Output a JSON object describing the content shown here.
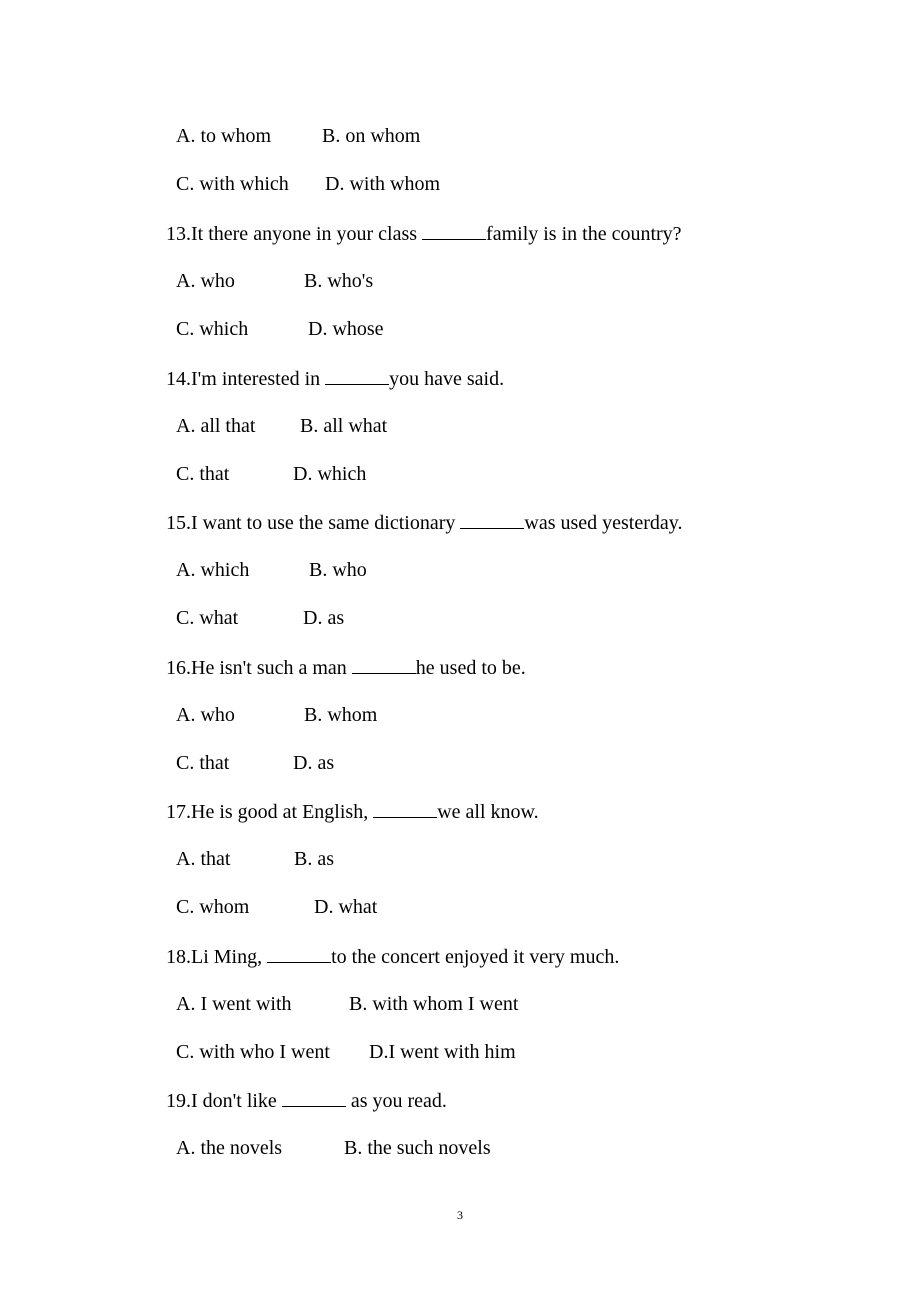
{
  "options_continued": {
    "rows": [
      [
        "A. to whom",
        "B. on whom"
      ],
      [
        "C. with which",
        "D. with whom"
      ]
    ]
  },
  "questions": [
    {
      "number": "13.",
      "before": "It there anyone in your class ",
      "after": "family is in the country?",
      "rows": [
        [
          "A. who",
          "B. who's"
        ],
        [
          "C. which",
          "D. whose"
        ]
      ]
    },
    {
      "number": "14.",
      "before": "I'm interested in ",
      "after": "you have said.",
      "rows": [
        [
          "A. all that",
          "B. all what"
        ],
        [
          "C. that",
          "D. which"
        ]
      ]
    },
    {
      "number": "15.",
      "before": "I want to use the same dictionary ",
      "after": "was used yesterday.",
      "rows": [
        [
          "A. which",
          "B. who"
        ],
        [
          "C. what",
          "D. as"
        ]
      ]
    },
    {
      "number": "16.",
      "before": "He isn't such a man ",
      "after": "he used to be.",
      "rows": [
        [
          "A. who",
          "B. whom"
        ],
        [
          "C. that",
          "D. as"
        ]
      ]
    },
    {
      "number": "17.",
      "before": "He is good at English, ",
      "after": "we all know.",
      "rows": [
        [
          "A. that",
          "B. as"
        ],
        [
          "C. whom",
          "D. what"
        ]
      ]
    },
    {
      "number": "18.",
      "before": "Li Ming, ",
      "after": "to the concert enjoyed it very much.",
      "rows": [
        [
          "A. I went with",
          "B. with whom I went"
        ],
        [
          "C. with who I went",
          "D.I went with him"
        ]
      ]
    },
    {
      "number": "19.",
      "before": "I don't like ",
      "after": " as you read.",
      "rows": [
        [
          "A. the novels",
          "B. the such novels"
        ]
      ]
    }
  ],
  "footer": {
    "page_number": "3"
  }
}
